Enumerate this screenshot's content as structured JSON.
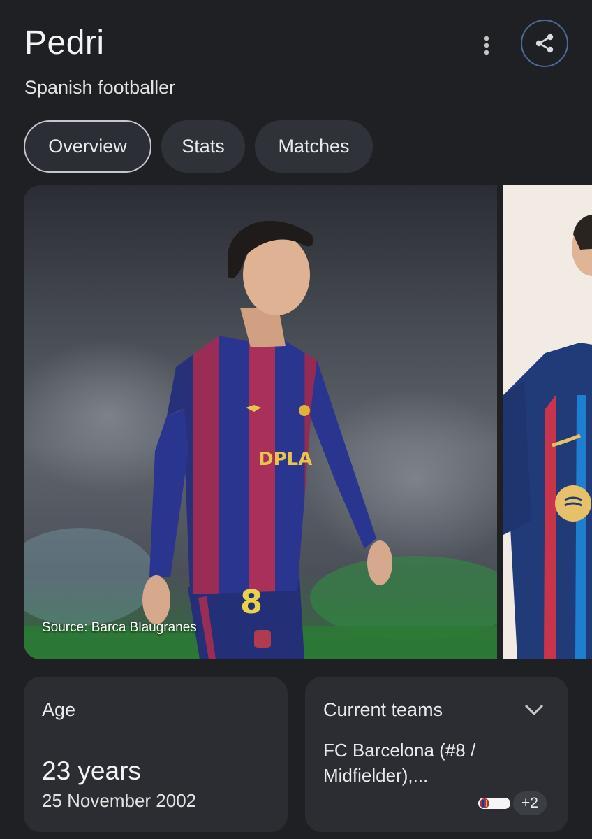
{
  "header": {
    "title": "Pedri",
    "subtitle": "Spanish footballer",
    "more_icon": "more-vert-icon",
    "share_icon": "share-icon"
  },
  "tabs": [
    {
      "label": "Overview",
      "active": true
    },
    {
      "label": "Stats",
      "active": false
    },
    {
      "label": "Matches",
      "active": false
    }
  ],
  "gallery": {
    "source_caption": "Source: Barca Blaugranes",
    "shirt_number": "8",
    "sponsor": "Spotify",
    "sponsor_main": "DPLA"
  },
  "age_card": {
    "label": "Age",
    "value": "23 years",
    "date": "25 November 2002"
  },
  "teams_card": {
    "label": "Current teams",
    "team_line": "FC Barcelona (#8 / Midfielder),...",
    "extra_count": "+2",
    "expand_icon": "chevron-down-icon"
  },
  "colors": {
    "background": "#1f2024",
    "card": "#2b2d33",
    "share_ring": "#4b6a96",
    "tab_active_border": "#c4c7cf"
  }
}
